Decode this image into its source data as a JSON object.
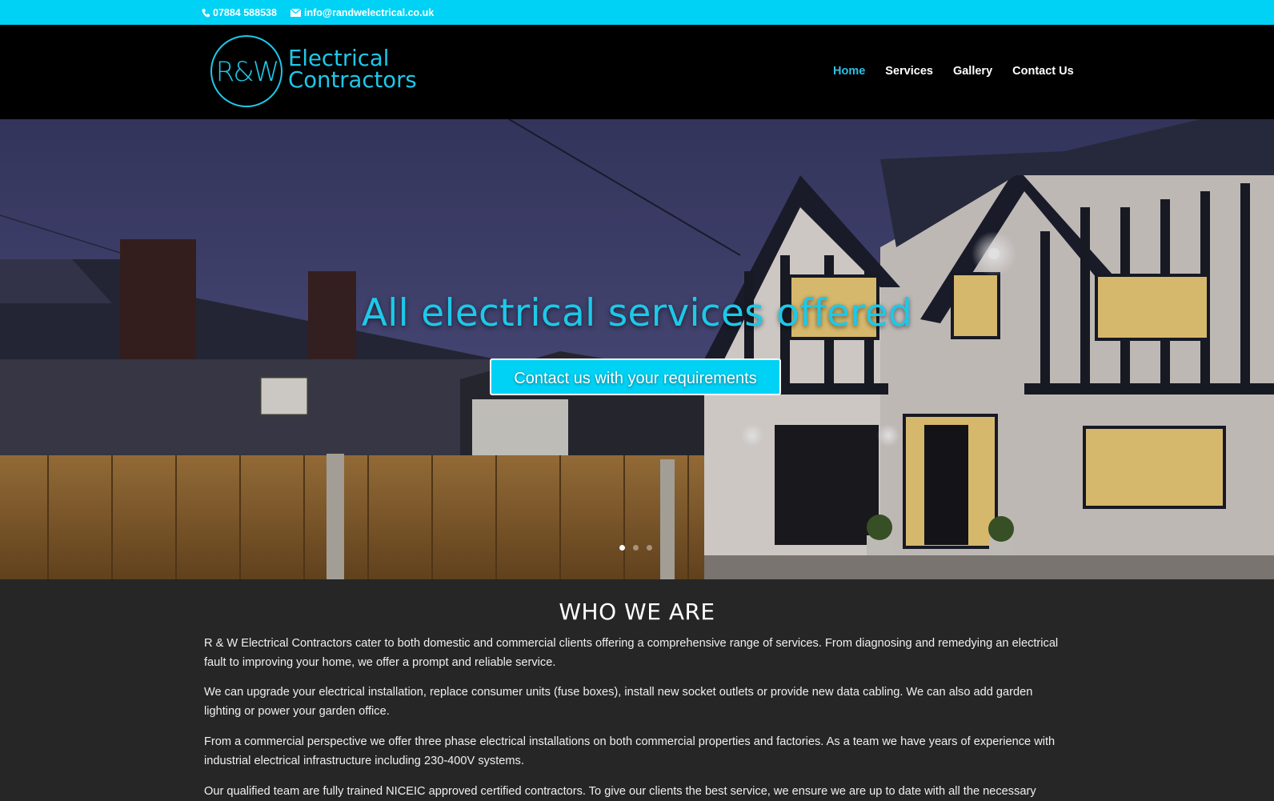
{
  "topbar": {
    "phone": "07884 588538",
    "email": "info@randwelectrical.co.uk",
    "background": "#00d2f5"
  },
  "header": {
    "logo": {
      "mark": "R&W",
      "line1": "Electrical",
      "line2": "Contractors"
    },
    "nav": [
      {
        "label": "Home",
        "active": true
      },
      {
        "label": "Services",
        "active": false
      },
      {
        "label": "Gallery",
        "active": false
      },
      {
        "label": "Contact Us",
        "active": false
      }
    ]
  },
  "hero": {
    "title": "All electrical services offered",
    "button_label": "Contact us with your requirements",
    "slides": 3,
    "active_slide": 1
  },
  "about": {
    "heading": "WHO WE ARE",
    "paragraphs": [
      "R & W Electrical Contractors cater to both domestic and commercial clients offering a comprehensive range of services. From diagnosing and remedying an electrical fault to improving your home, we offer a prompt and reliable service.",
      "We can upgrade your electrical installation, replace consumer units (fuse boxes), install new socket outlets or provide new data cabling. We can also add garden lighting or power your garden office.",
      "From a commercial perspective we offer three phase electrical installations on both commercial properties and factories. As a team we have years of experience with industrial electrical infrastructure including 230-400V systems.",
      "Our qualified team are fully trained NICEIC approved certified contractors. To give our clients the best service, we ensure we are up to date with all the necessary"
    ]
  },
  "colors": {
    "accent": "#1ec8e8",
    "header_bg": "#000000",
    "content_bg": "#262626"
  }
}
